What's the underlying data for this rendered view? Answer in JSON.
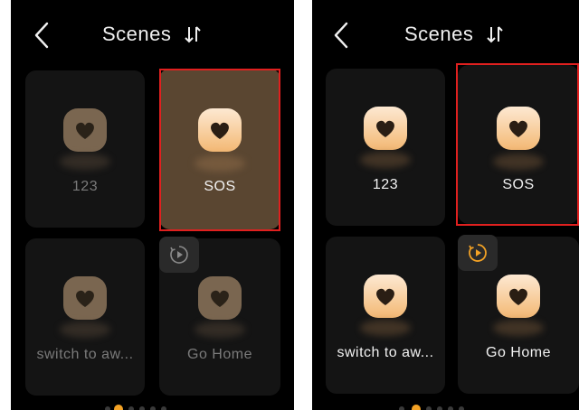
{
  "screens": [
    {
      "id": "before",
      "header": {
        "title": "Scenes"
      },
      "tiles": [
        {
          "label": "123",
          "active": false
        },
        {
          "label": "SOS",
          "active": true,
          "selected": true
        },
        {
          "label": "switch to aw...",
          "active": false
        },
        {
          "label": "Go Home",
          "active": false,
          "has_play_badge": true
        }
      ],
      "pagination": {
        "count": 6,
        "active_index": 0
      }
    },
    {
      "id": "after",
      "header": {
        "title": "Scenes"
      },
      "tiles": [
        {
          "label": "123",
          "active": true
        },
        {
          "label": "SOS",
          "active": true,
          "selected": true
        },
        {
          "label": "switch to aw...",
          "active": true
        },
        {
          "label": "Go Home",
          "active": true,
          "has_play_badge": true
        }
      ],
      "pagination": {
        "count": 6,
        "active_index": 0
      }
    }
  ],
  "icons": {
    "back": "chevron-left-icon",
    "sort": "sort-arrows-icon",
    "scene": "heart-icon",
    "play": "play-circle-icon"
  },
  "colors": {
    "background": "#000000",
    "tile_bg": "#141414",
    "selected_tile_bg": "#5a4631",
    "selection_border": "#e0201f",
    "accent": "#f3a225",
    "text_active": "#f2f2f2",
    "text_dim": "#7a7a7a"
  }
}
